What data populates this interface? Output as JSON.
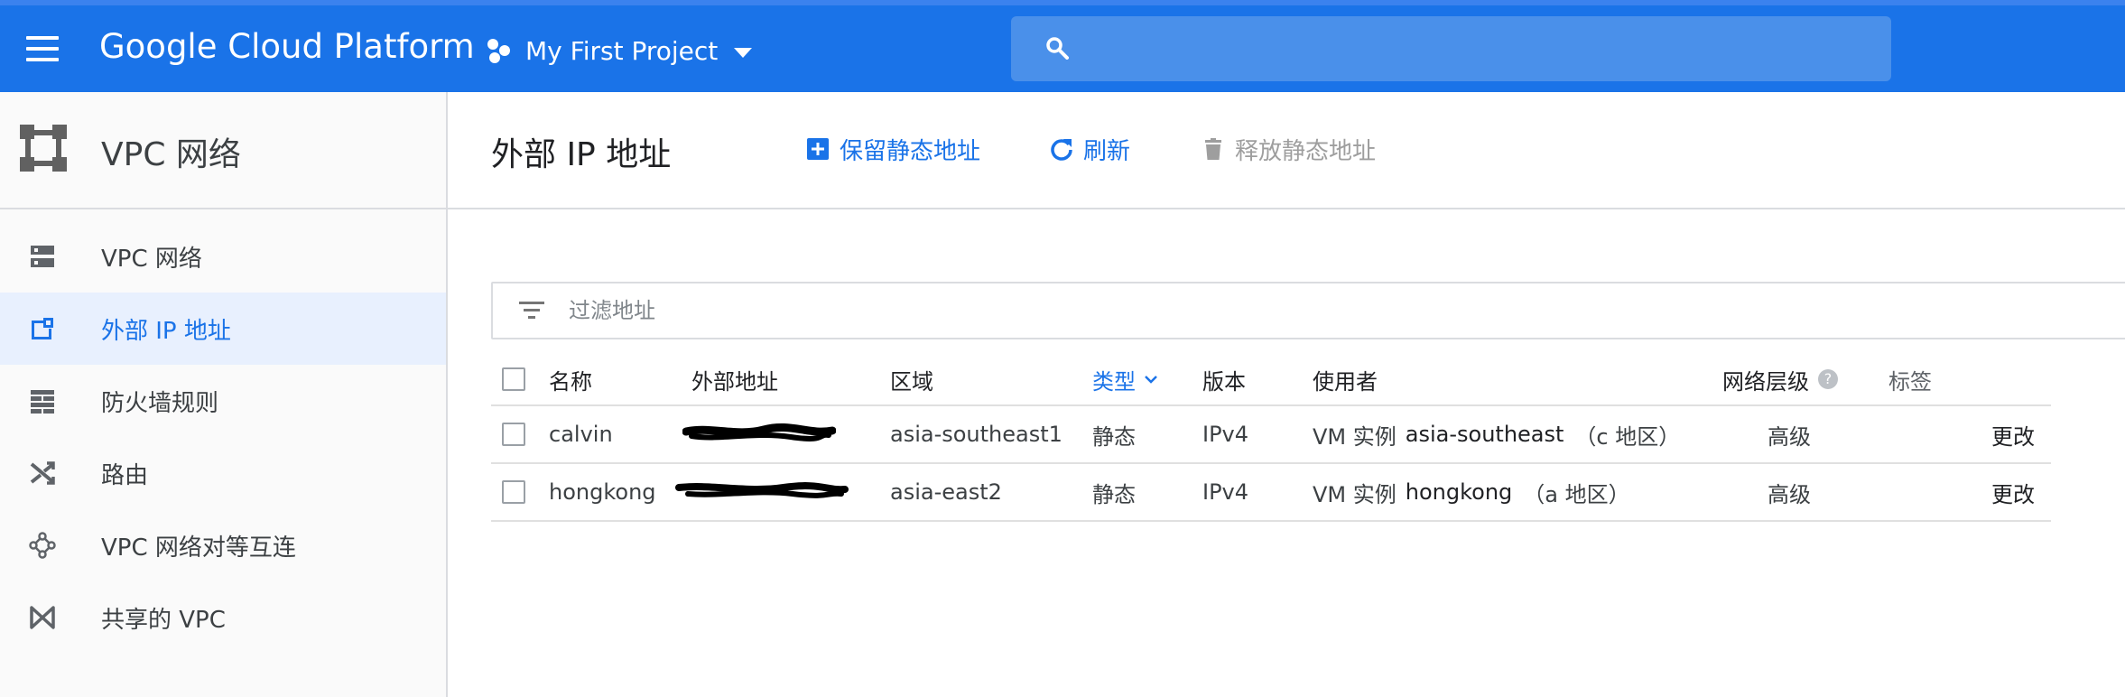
{
  "topbar": {
    "brand": "Google Cloud Platform",
    "project": "My First Project",
    "search_placeholder": ""
  },
  "sidebar": {
    "title": "VPC 网络",
    "items": [
      {
        "label": "VPC 网络",
        "icon": "vpc-network-icon"
      },
      {
        "label": "外部 IP 地址",
        "icon": "external-ip-icon",
        "active": true
      },
      {
        "label": "防火墙规则",
        "icon": "firewall-icon"
      },
      {
        "label": "路由",
        "icon": "routes-icon"
      },
      {
        "label": "VPC 网络对等互连",
        "icon": "peering-icon"
      },
      {
        "label": "共享的 VPC",
        "icon": "shared-vpc-icon"
      }
    ]
  },
  "main": {
    "title": "外部 IP 地址",
    "actions": {
      "reserve": "保留静态地址",
      "refresh": "刷新",
      "release": "释放静态地址"
    },
    "filter_placeholder": "过滤地址"
  },
  "table": {
    "headers": {
      "name": "名称",
      "address": "外部地址",
      "region": "区域",
      "type": "类型",
      "version": "版本",
      "user": "使用者",
      "tier": "网络层级",
      "labels": "标签"
    },
    "rows": [
      {
        "name": "calvin",
        "region": "asia-southeast1",
        "type": "静态",
        "version": "IPv4",
        "user_prefix": "VM 实例",
        "user_instance": "asia-southeast",
        "user_zone": "（c 地区）",
        "tier": "高级",
        "action": "更改"
      },
      {
        "name": "hongkong",
        "region": "asia-east2",
        "type": "静态",
        "version": "IPv4",
        "user_prefix": "VM 实例",
        "user_instance": "hongkong",
        "user_zone": "（a 地区）",
        "tier": "高级",
        "action": "更改"
      }
    ]
  },
  "colors": {
    "brand_blue": "#1a73e8",
    "active_bg": "#e8f0fe",
    "disabled": "#9e9e9e"
  }
}
